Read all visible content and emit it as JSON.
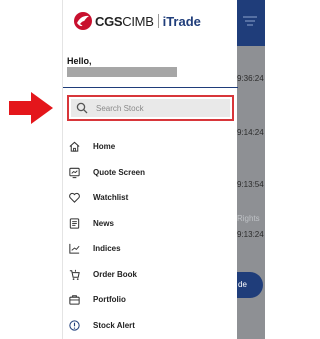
{
  "app": {
    "brand_bold": "CGS",
    "brand_regular": "CIMB",
    "product": "iTrade",
    "accent_color": "#1f3d7a",
    "brand_red": "#c8102e"
  },
  "drawer": {
    "greeting": "Hello,",
    "search": {
      "placeholder": "Search Stock",
      "value": ""
    },
    "highlight_color": "#d8363a",
    "items": [
      {
        "label": "Home",
        "icon": "home-icon"
      },
      {
        "label": "Quote Screen",
        "icon": "quote-screen-icon"
      },
      {
        "label": "Watchlist",
        "icon": "heart-icon"
      },
      {
        "label": "News",
        "icon": "news-icon"
      },
      {
        "label": "Indices",
        "icon": "chart-icon"
      },
      {
        "label": "Order Book",
        "icon": "order-book-icon"
      },
      {
        "label": "Portfolio",
        "icon": "briefcase-icon"
      },
      {
        "label": "Stock Alert",
        "icon": "alert-icon"
      }
    ]
  },
  "background": {
    "times": [
      "9:36:24",
      "9:14:24",
      "9:13:54",
      "9:13:24"
    ],
    "rights_label": "Rights",
    "pill_label": "de"
  }
}
